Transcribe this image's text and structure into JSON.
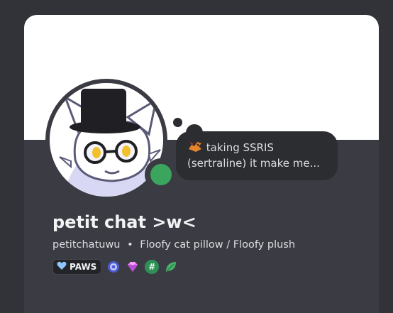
{
  "profile": {
    "display_name": "petit chat >w<",
    "username": "petitchatuwu",
    "separator": "•",
    "pronouns_or_bio": "Floofy cat pillow / Floofy plush",
    "status_text": "taking SSRIS (sertraline) it make me...",
    "status_emoji": "dragon-emoji-icon",
    "online_status_color": "#3ba55d"
  },
  "server_tag": {
    "label": "PAWS",
    "icon": "heart-icon"
  },
  "badges": [
    {
      "name": "hypesquad-badge",
      "color": "#7289da"
    },
    {
      "name": "nitro-gem-badge",
      "color": "#f47fff"
    },
    {
      "name": "hashtag-badge",
      "color": "#3ba55d",
      "symbol": "#"
    },
    {
      "name": "leaf-badge",
      "color": "#3ba55d"
    }
  ],
  "colors": {
    "banner": "#ffffff",
    "card_background": "#3b3c43",
    "page_background": "#313338",
    "thought_bubble": "#2b2d31"
  }
}
